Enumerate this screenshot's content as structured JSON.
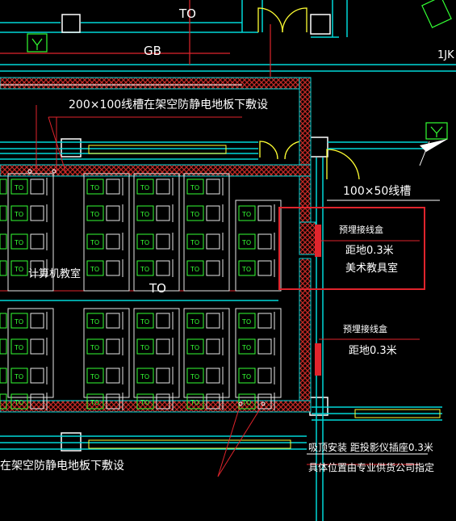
{
  "labels": {
    "to_top": "TO",
    "gb": "GB",
    "jk": "1JK",
    "trunking_top": "200×100线槽在架空防静电地板下敷设",
    "trunking_right": "100×50线槽",
    "box1_title": "预埋接线盒",
    "box1_height": "距地0.3米",
    "art_room": "美术教具室",
    "computer_room": "计算机教室",
    "to_mid": "TO",
    "box2_title": "预埋接线盒",
    "box2_height": "距地0.3米",
    "trunking_bottom": "在架空防静电地板下敷设",
    "note_line1": "吸顶安装 距投影仪插座0.3米",
    "note_line2": "具体位置由专业供货公司指定"
  },
  "desk_tag": "TO",
  "colors": {
    "background": "#000000",
    "wall_cyan": "#00e5e5",
    "hatch_red": "#d8322c",
    "desk_green": "#33ff33",
    "highlight_red": "#e0242c",
    "text_white": "#ffffff",
    "door_yellow": "#ffff33"
  },
  "icons": [
    "socket-symbol",
    "door-swing",
    "junction-box",
    "projector-outlet"
  ]
}
